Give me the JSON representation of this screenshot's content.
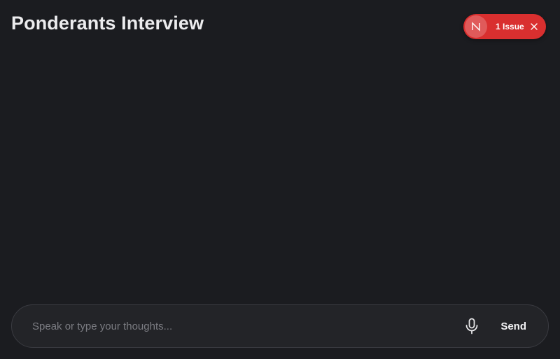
{
  "header": {
    "title": "Ponderants Interview"
  },
  "issue_badge": {
    "logo_letter": "N",
    "label": "1 Issue",
    "logo_icon": "nextjs-logo-icon",
    "close_icon": "close-icon",
    "color": "#d92f2f"
  },
  "composer": {
    "value": "",
    "placeholder": "Speak or type your thoughts...",
    "mic_icon": "microphone-icon",
    "send_label": "Send"
  },
  "theme": {
    "background": "#1b1c20",
    "accent_error": "#d92f2f"
  }
}
